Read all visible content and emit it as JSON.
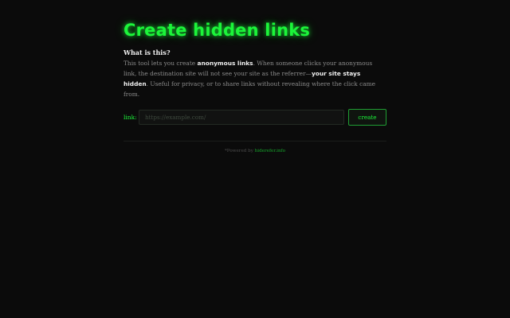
{
  "page": {
    "title": "Create hidden links"
  },
  "info": {
    "heading": "What is this?",
    "p1": "This tool lets you create ",
    "strong1": "anonymous links",
    "p2": ". When someone clicks your anonymous link, the destination site will not see your site as the referrer—",
    "strong2": "your site stays hidden",
    "p3": ". Useful for privacy, or to share links without revealing where the click came from."
  },
  "form": {
    "link_label": "link:",
    "url_value": "",
    "url_placeholder": "https://example.com/",
    "create_label": "create"
  },
  "footer": {
    "prefix": "*Powered by ",
    "link_text": "hiderefer.info"
  },
  "colors": {
    "accent": "#1cf53a",
    "background": "#0b0b0b"
  }
}
